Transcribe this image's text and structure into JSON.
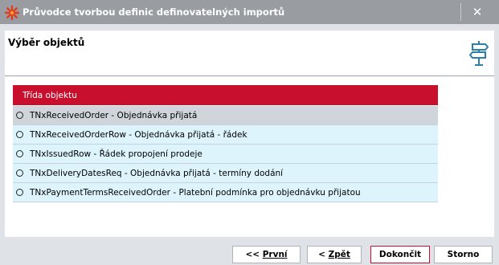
{
  "window": {
    "title": "Průvodce tvorbou definic definovatelných importů",
    "close_label": "✕"
  },
  "header": {
    "title": "Výběr objektů",
    "icon": "signpost-icon"
  },
  "grid": {
    "column_header": "Třída objektu",
    "rows": [
      {
        "label": "TNxReceivedOrder - Objednávka přijatá",
        "selected": true
      },
      {
        "label": "TNxReceivedOrderRow - Objednávka přijatá - řádek",
        "selected": false
      },
      {
        "label": "TNxIssuedRow - Řádek propojení prodeje",
        "selected": false
      },
      {
        "label": "TNxDeliveryDatesReq - Objednávka přijatá - termíny dodání",
        "selected": false
      },
      {
        "label": "TNxPaymentTermsReceivedOrder - Platební podmínka pro objednávku přijatou",
        "selected": false
      }
    ]
  },
  "buttons": {
    "first_prefix": "<< ",
    "first_label": "První",
    "back_prefix": "< ",
    "back_label": "Zpět",
    "finish_label": "Dokončit",
    "cancel_label": "Storno"
  },
  "colors": {
    "accent_red": "#c8102e",
    "titlebar": "#999da2",
    "row_bg": "#ddf4fd",
    "row_selected_bg": "#cfd5db"
  }
}
